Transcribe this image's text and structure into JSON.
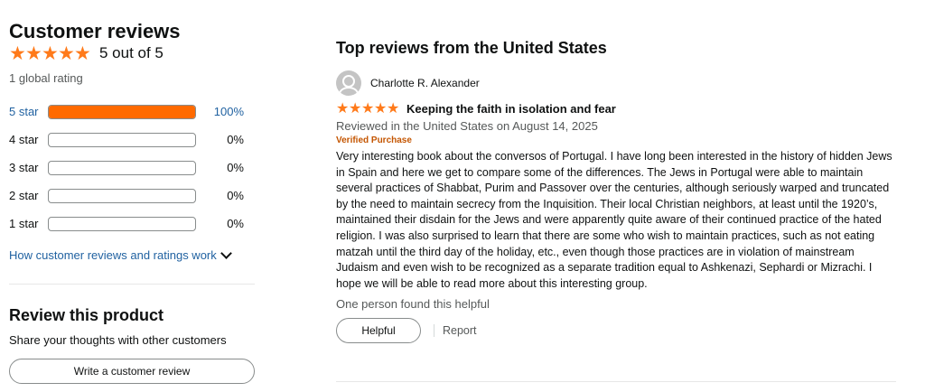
{
  "summary": {
    "heading": "Customer reviews",
    "overall_text": "5 out of 5",
    "global_rating": "1 global rating",
    "rating_stars": 5,
    "histogram": [
      {
        "label": "5 star",
        "percent_text": "100%",
        "percent": 100
      },
      {
        "label": "4 star",
        "percent_text": "0%",
        "percent": 0
      },
      {
        "label": "3 star",
        "percent_text": "0%",
        "percent": 0
      },
      {
        "label": "2 star",
        "percent_text": "0%",
        "percent": 0
      },
      {
        "label": "1 star",
        "percent_text": "0%",
        "percent": 0
      }
    ],
    "how_link": "How customer reviews and ratings work"
  },
  "review_product": {
    "heading": "Review this product",
    "subtext": "Share your thoughts with other customers",
    "button": "Write a customer review"
  },
  "reviews": {
    "heading": "Top reviews from the United States",
    "items": [
      {
        "reviewer": "Charlotte R. Alexander",
        "rating_stars": 5,
        "title": "Keeping the faith in isolation and fear",
        "reviewed_on": "Reviewed in the United States on August 14, 2025",
        "verified": "Verified Purchase",
        "body": "Very interesting book about the conversos of Portugal. I have long been interested in the history of hidden Jews in Spain and here we get to compare some of the differences. The Jews in Portugal were able to maintain several practices of Shabbat, Purim and Passover over the centuries, although seriously warped and truncated by the need to maintain secrecy from the Inquisition. Their local Christian neighbors, at least until the 1920’s, maintained their disdain for the Jews and were apparently quite aware of their continued practice of the hated religion. I was also surprised to learn that there are some who wish to maintain practices, such as not eating matzah until the third day of the holiday, etc., even though those practices are in violation of mainstream Judaism and even wish to be recognized as a separate tradition equal to Ashkenazi, Sephardi or Mizrachi. I hope we will be able to read more about this interesting group.",
        "helpful_text": "One person found this helpful",
        "helpful_button": "Helpful",
        "report": "Report"
      }
    ]
  },
  "colors": {
    "star": "#ff7a1a",
    "bar_fill": "#ff6a00",
    "link": "#2162a1",
    "verified": "#c45500"
  }
}
